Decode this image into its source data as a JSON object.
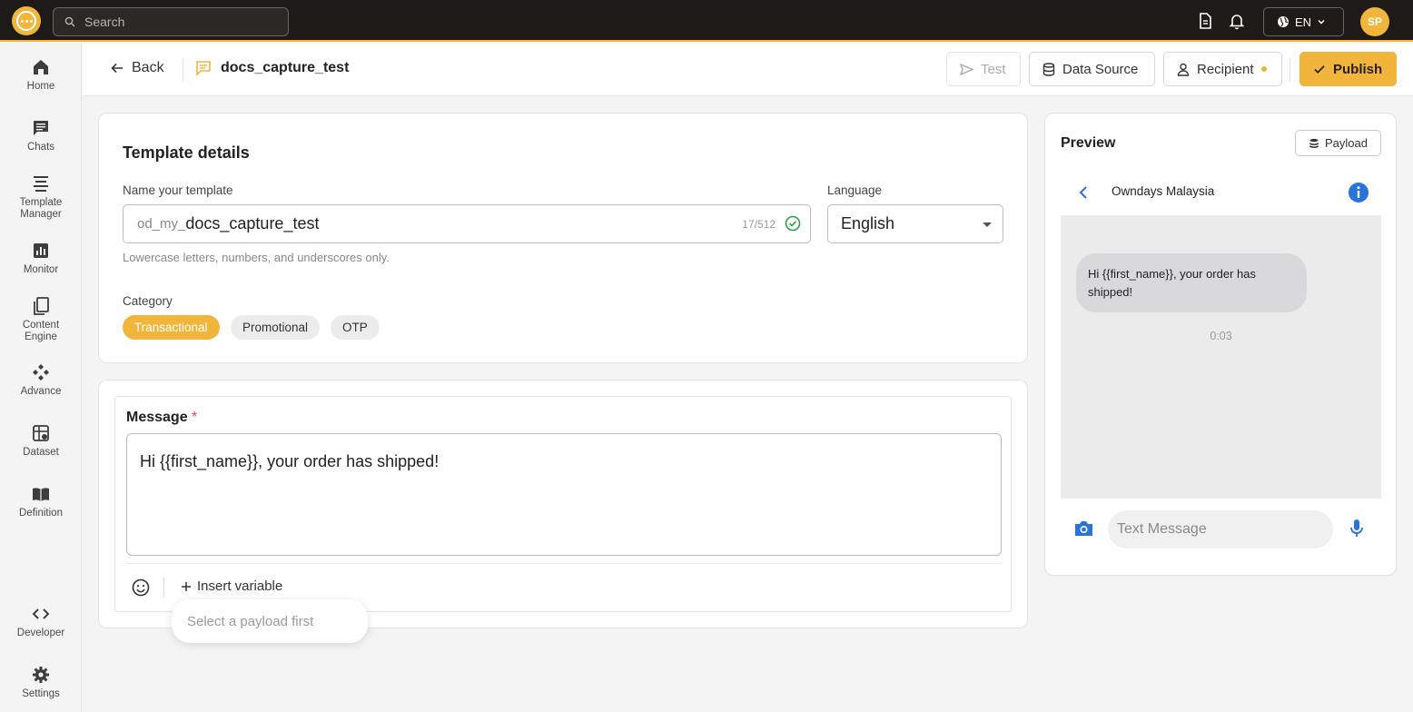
{
  "topbar": {
    "search_placeholder": "Search",
    "language": "EN",
    "avatar_initials": "SP"
  },
  "sidebar": {
    "items": [
      {
        "label": "Home",
        "icon": "home-icon"
      },
      {
        "label": "Chats",
        "icon": "chat-icon"
      },
      {
        "label": "Template Manager",
        "icon": "template-icon"
      },
      {
        "label": "Monitor",
        "icon": "monitor-icon"
      },
      {
        "label": "Content Engine",
        "icon": "content-icon"
      },
      {
        "label": "Advance",
        "icon": "advance-icon"
      },
      {
        "label": "Dataset",
        "icon": "dataset-icon"
      },
      {
        "label": "Definition",
        "icon": "definition-icon"
      },
      {
        "label": "Developer",
        "icon": "code-icon"
      },
      {
        "label": "Settings",
        "icon": "gear-icon"
      }
    ]
  },
  "header": {
    "back_label": "Back",
    "template_name": "docs_capture_test",
    "test_label": "Test",
    "data_source_label": "Data Source",
    "recipient_label": "Recipient",
    "publish_label": "Publish"
  },
  "details": {
    "title": "Template details",
    "name_label": "Name your template",
    "name_prefix": "od_my_",
    "name_value": "docs_capture_test",
    "name_counter": "17/512",
    "name_hint": "Lowercase letters, numbers, and underscores only.",
    "language_label": "Language",
    "language_value": "English",
    "category_label": "Category",
    "categories": [
      "Transactional",
      "Promotional",
      "OTP"
    ],
    "selected_category": "Transactional"
  },
  "message": {
    "label": "Message",
    "required_mark": "*",
    "body": "Hi {{first_name}}, your order has shipped!",
    "insert_variable_label": "Insert variable",
    "tooltip": "Select a payload first"
  },
  "preview": {
    "title": "Preview",
    "payload_label": "Payload",
    "contact_name": "Owndays Malaysia",
    "bubble_text": "Hi {{first_name}}, your order has shipped!",
    "bubble_time": "0:03",
    "input_placeholder": "Text Message"
  },
  "colors": {
    "accent": "#f0b53a",
    "topbar_bg": "#1d1a18",
    "link_blue": "#2a73d9"
  }
}
